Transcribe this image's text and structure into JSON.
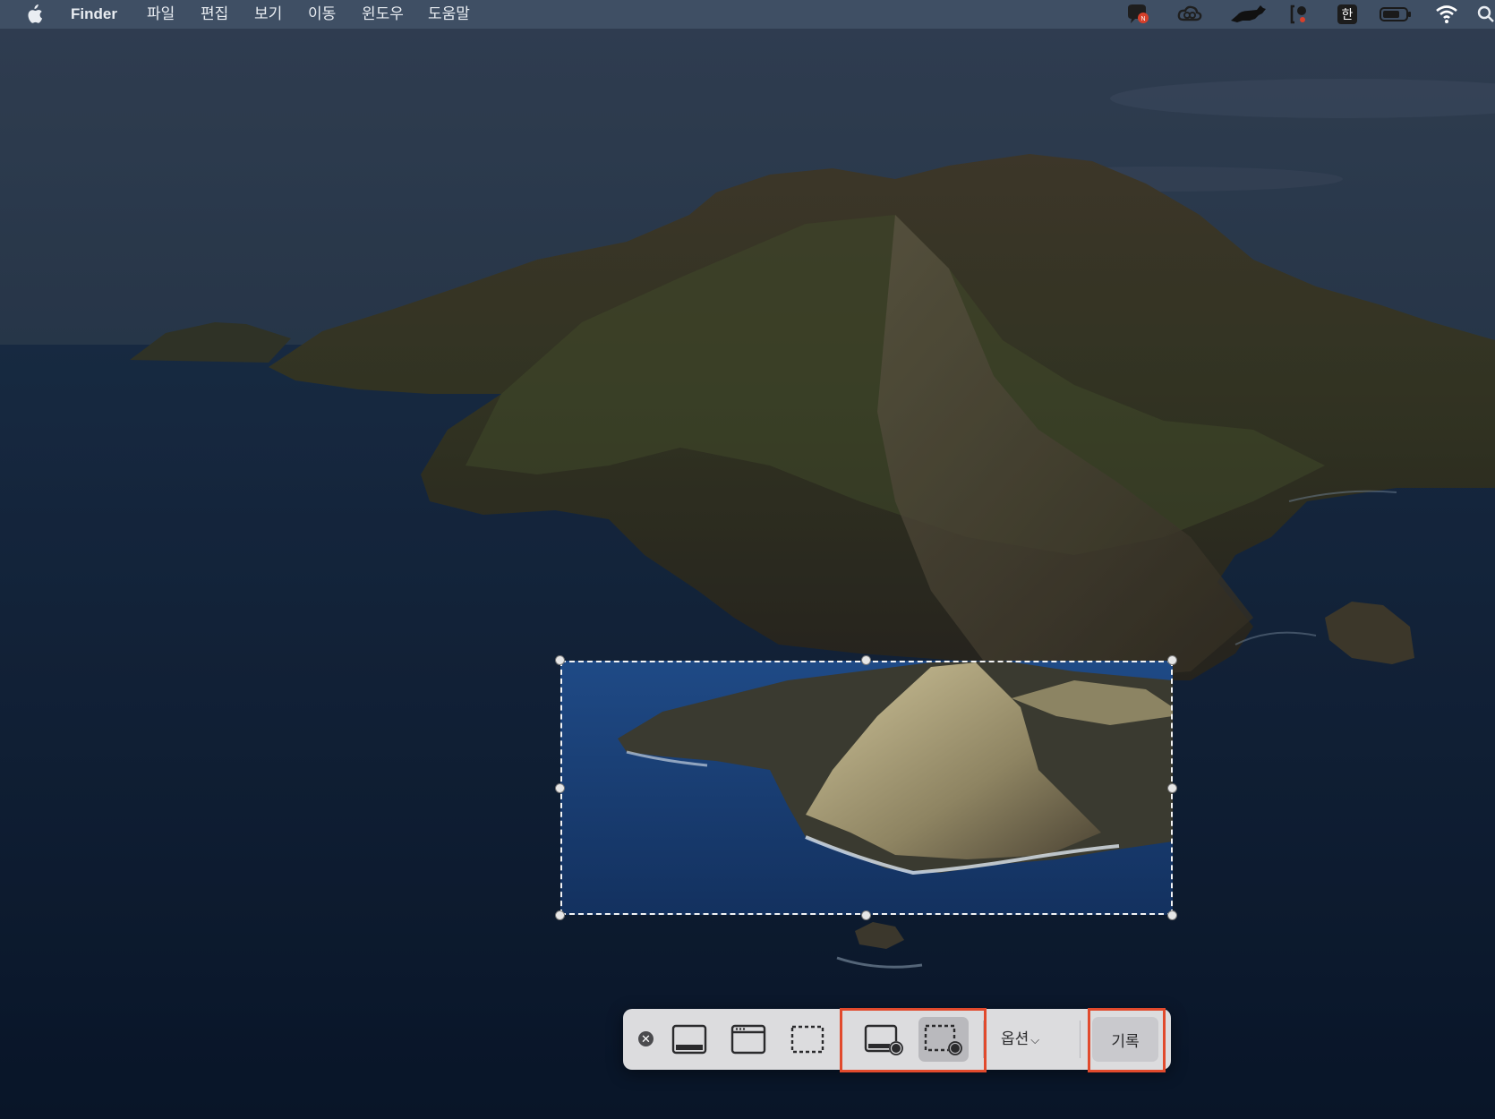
{
  "menubar": {
    "app_name": "Finder",
    "items": [
      "파일",
      "편집",
      "보기",
      "이동",
      "윈도우",
      "도움말"
    ],
    "status_icons": [
      "chat-notification-icon",
      "creative-cloud-icon",
      "sheep-icon",
      "screen-record-indicator-icon",
      "input-source-icon",
      "battery-icon",
      "wifi-icon",
      "search-icon"
    ],
    "input_source": "한"
  },
  "toolbar": {
    "buttons": [
      "capture-entire-screen",
      "capture-selected-window",
      "capture-selected-portion",
      "record-entire-screen",
      "record-selected-portion"
    ],
    "selected_button": "record-selected-portion",
    "options_label": "옵션",
    "record_label": "기록"
  },
  "colors": {
    "highlight": "#e14a2d",
    "toolbar_bg": "#dcdcde",
    "menubar_bg": "#3f4f64"
  }
}
